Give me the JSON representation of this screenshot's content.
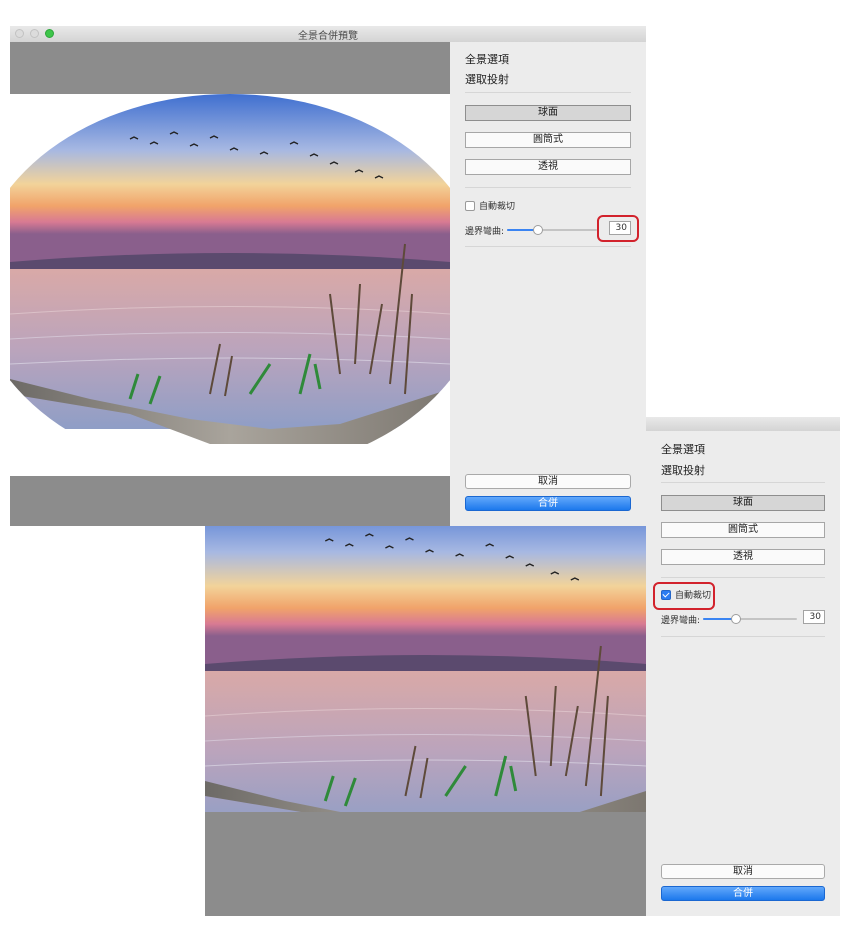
{
  "window_top": {
    "title": "全景合併預覽",
    "panel": {
      "heading": "全景選項",
      "subheading": "選取投射",
      "projection_options": [
        "球面",
        "圓筒式",
        "透視"
      ],
      "selected_projection": "球面",
      "auto_crop_label": "自動裁切",
      "auto_crop_checked": false,
      "boundary_warp_label": "邊界彎曲:",
      "boundary_warp_value": "30",
      "cancel_label": "取消",
      "merge_label": "合併"
    }
  },
  "window_bottom": {
    "panel": {
      "heading": "全景選項",
      "subheading": "選取投射",
      "projection_options": [
        "球面",
        "圓筒式",
        "透視"
      ],
      "selected_projection": "球面",
      "auto_crop_label": "自動裁切",
      "auto_crop_checked": true,
      "boundary_warp_label": "邊界彎曲:",
      "boundary_warp_value": "30",
      "cancel_label": "取消",
      "merge_label": "合併"
    }
  },
  "slider_fraction": 0.35,
  "colors": {
    "callout": "#d2222c",
    "accent": "#1c78ec",
    "preview_background": "#8c8c8c"
  }
}
